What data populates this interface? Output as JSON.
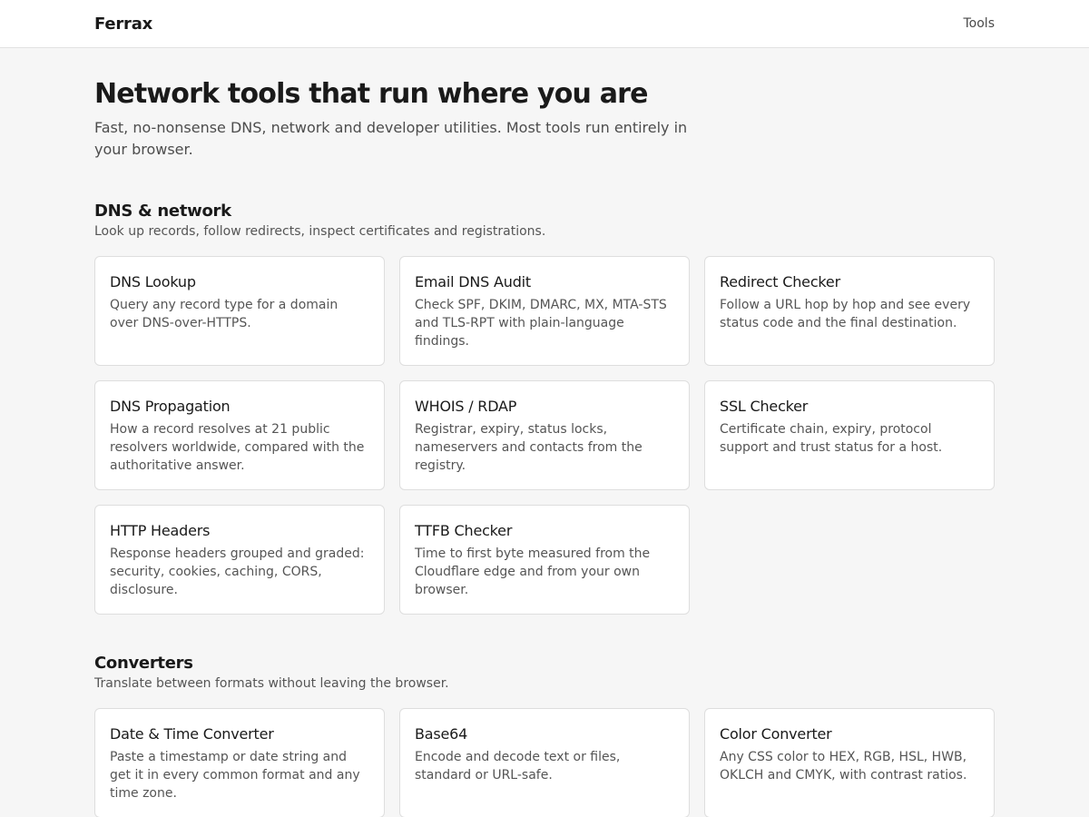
{
  "header": {
    "brand": "Ferrax",
    "nav_tools": "Tools"
  },
  "hero": {
    "title": "Network tools that run where you are",
    "subtitle": "Fast, no-nonsense DNS, network and developer utilities. Most tools run entirely in your browser."
  },
  "sections": [
    {
      "title": "DNS & network",
      "description": "Look up records, follow redirects, inspect certificates and registrations.",
      "cards": [
        {
          "title": "DNS Lookup",
          "description": "Query any record type for a domain over DNS-over-HTTPS."
        },
        {
          "title": "Email DNS Audit",
          "description": "Check SPF, DKIM, DMARC, MX, MTA-STS and TLS-RPT with plain-language findings."
        },
        {
          "title": "Redirect Checker",
          "description": "Follow a URL hop by hop and see every status code and the final destination."
        },
        {
          "title": "DNS Propagation",
          "description": "How a record resolves at 21 public resolvers worldwide, compared with the authoritative answer."
        },
        {
          "title": "WHOIS / RDAP",
          "description": "Registrar, expiry, status locks, nameservers and contacts from the registry."
        },
        {
          "title": "SSL Checker",
          "description": "Certificate chain, expiry, protocol support and trust status for a host."
        },
        {
          "title": "HTTP Headers",
          "description": "Response headers grouped and graded: security, cookies, caching, CORS, disclosure."
        },
        {
          "title": "TTFB Checker",
          "description": "Time to first byte measured from the Cloudflare edge and from your own browser."
        }
      ]
    },
    {
      "title": "Converters",
      "description": "Translate between formats without leaving the browser.",
      "cards": [
        {
          "title": "Date & Time Converter",
          "description": "Paste a timestamp or date string and get it in every common format and any time zone."
        },
        {
          "title": "Base64",
          "description": "Encode and decode text or files, standard or URL-safe."
        },
        {
          "title": "Color Converter",
          "description": "Any CSS color to HEX, RGB, HSL, HWB, OKLCH and CMYK, with contrast ratios."
        }
      ]
    }
  ]
}
